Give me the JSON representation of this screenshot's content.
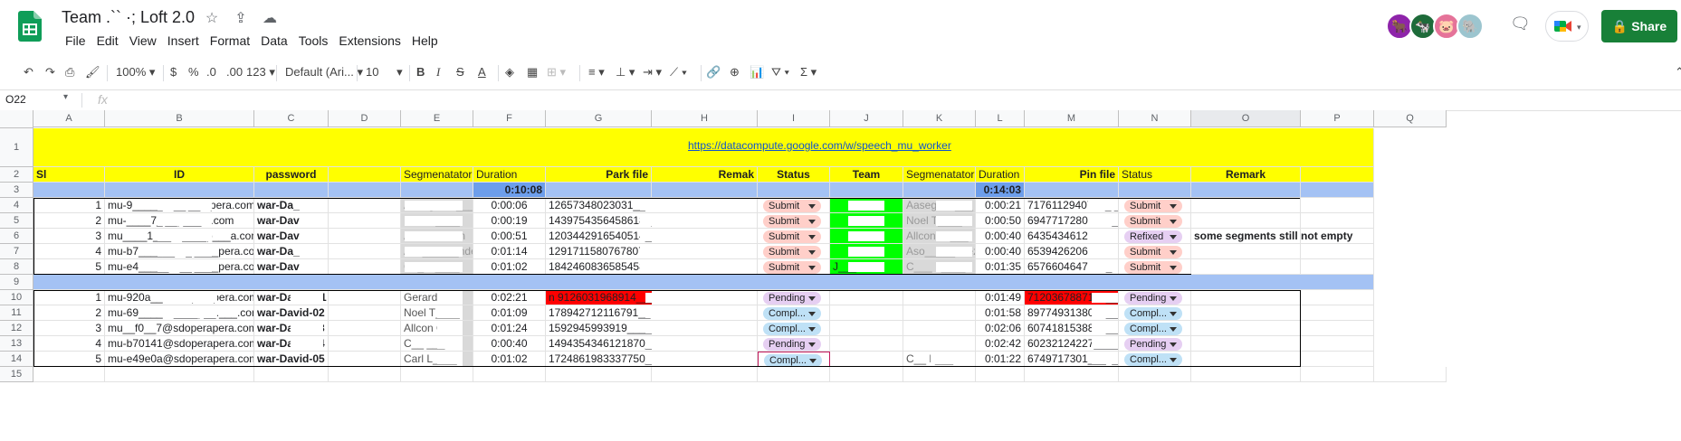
{
  "app": {
    "doc_title": "Team .`` ·; Loft 2.0",
    "menu": [
      "File",
      "Edit",
      "View",
      "Insert",
      "Format",
      "Data",
      "Tools",
      "Extensions",
      "Help"
    ],
    "share_label": "Share"
  },
  "toolbar": {
    "zoom": "100%",
    "currency": "$",
    "percent": "%",
    "dec_less": ".0",
    "dec_more": ".00",
    "more_formats": "123",
    "font": "Default (Ari...",
    "font_size": "10"
  },
  "formula_bar": {
    "name_box": "O22",
    "fx": "fx"
  },
  "columns": [
    "A",
    "B",
    "C",
    "D",
    "E",
    "F",
    "G",
    "H",
    "I",
    "J",
    "K",
    "L",
    "M",
    "N",
    "O",
    "P",
    "Q"
  ],
  "rows": [
    "1",
    "2",
    "3",
    "4",
    "5",
    "6",
    "7",
    "8",
    "9",
    "10",
    "11",
    "12",
    "13",
    "14",
    "15"
  ],
  "sheet": {
    "link": "https://datacompute.google.com/w/speech_mu_worker",
    "headers": {
      "A": "Sl",
      "B": "ID",
      "C": "password",
      "E": "Segmenatator",
      "F": "Duration",
      "G": "Park file",
      "H": "Remak",
      "I": "Status",
      "J": "Team",
      "K": "Segmenatator",
      "L": "Duration",
      "M": "Pin file",
      "N": "Status",
      "O": "Remark"
    },
    "total_f": "0:10:08",
    "total_l": "0:14:03",
    "block1": [
      {
        "sl": "1",
        "id": "mu-9_____@__l__rapera.com",
        "pw": "war-Da__1 01",
        "seg": "Aasegu An___",
        "dur": "0:00:06",
        "park": "12657348023031__T1030",
        "status": "Submit",
        "team": "",
        "seg2": "Aasegu A ___",
        "dur2": "0:00:21",
        "pin": "7176112940719_._",
        "status2": "Submit",
        "remark": ""
      },
      {
        "sl": "2",
        "id": "mu-____7_l__p___.a.com",
        "pw": "war-David-02",
        "seg": "Noel T____",
        "dur": "0:00:19",
        "park": "14397543564586187_20",
        "status": "Submit",
        "team": "",
        "seg2": "Noel T____",
        "dur2": "0:00:50",
        "pin": "69477172800167_14",
        "status2": "Submit",
        "remark": ""
      },
      {
        "sl": "3",
        "id": "mu____1___@____p___a.com",
        "pw": "war-David-03",
        "seg": "Allcon Olddn",
        "dur": "0:00:51",
        "park": "1203442916540514__174",
        "status": "Submit",
        "team": "",
        "seg2": "Allcon O ___",
        "dur2": "0:00:40",
        "pin": "6435434612187990",
        "status2": "Refixed",
        "remark": "some segments still not empty"
      },
      {
        "sl": "4",
        "id": "mu-b7______@_l____pera.com",
        "pw": "war-Da__1 04",
        "seg": "Aso______ndez",
        "dur": "0:01:14",
        "park": "12917115807678078048",
        "status": "Submit",
        "team": "",
        "seg2": "Aso_____ndez",
        "dur2": "0:00:40",
        "pin": "6539426206049201_",
        "status2": "Submit",
        "remark": ""
      },
      {
        "sl": "5",
        "id": "mu-e4_____@__l____pera.com",
        "pw": "war-David-05",
        "seg": "Ca_l L____",
        "dur": "0:01:02",
        "park": "1842460836585458090__",
        "status": "Submit",
        "team": "J___",
        "seg2": "C___ L____",
        "dur2": "0:01:35",
        "pin": "6576604647855_10",
        "status2": "Submit",
        "remark": ""
      }
    ],
    "block2": [
      {
        "sl": "1",
        "id": "mu-920a__@sdoperapera.com",
        "pw": "war-Da__1 01",
        "seg": "Gerard N",
        "dur": "0:02:21",
        "park": "n 9126031968914___",
        "status": "Pending",
        "dur2": "0:01:49",
        "pin": "7120367887150__",
        "status2": "Pending"
      },
      {
        "sl": "2",
        "id": "mu-69____@____p__.___.com",
        "pw": "war-David-02",
        "seg": "Noel T____",
        "dur": "0:01:09",
        "park": "178942712116791__071",
        "status": "Compl...",
        "dur2": "0:01:58",
        "pin": "8977493138059__10",
        "status2": "Compl..."
      },
      {
        "sl": "3",
        "id": "mu__f0__7@sdoperapera.com",
        "pw": "war-David-03",
        "seg": "Allcon Olddn",
        "dur": "0:01:24",
        "park": "1592945993919_____10",
        "status": "Compl...",
        "dur2": "0:02:06",
        "pin": "6074181538864___",
        "status2": "Compl..."
      },
      {
        "sl": "4",
        "id": "mu-b70141@sdoperapera.com",
        "pw": "war-David-04",
        "seg": "C__ ___ z",
        "dur": "0:00:40",
        "park": "1494354346121870___0",
        "status": "Pending",
        "dur2": "0:02:42",
        "pin": "60232124227_____0",
        "status2": "Pending"
      },
      {
        "sl": "5",
        "id": "mu-e49e0a@sdoperapera.com",
        "pw": "war-David-05",
        "seg": "Carl L____",
        "dur": "0:01:02",
        "park": "1724861983337750__17",
        "status": "Compl...",
        "seg2": "C__ L___",
        "dur2": "0:01:22",
        "pin": "6749717301___1_470",
        "status2": "Compl..."
      }
    ]
  },
  "colors": {
    "yellow": "#ffff00",
    "blue_band": "#a4c2f4",
    "total_blue": "#6d9eeb",
    "green": "#00ff00",
    "red": "#ff0000",
    "submit_chip": "#ffcfc9",
    "refixed_chip": "#e6cff2",
    "pending_chip": "#e6cff2",
    "complete_chip": "#bfe1f6",
    "share": "#188038"
  }
}
